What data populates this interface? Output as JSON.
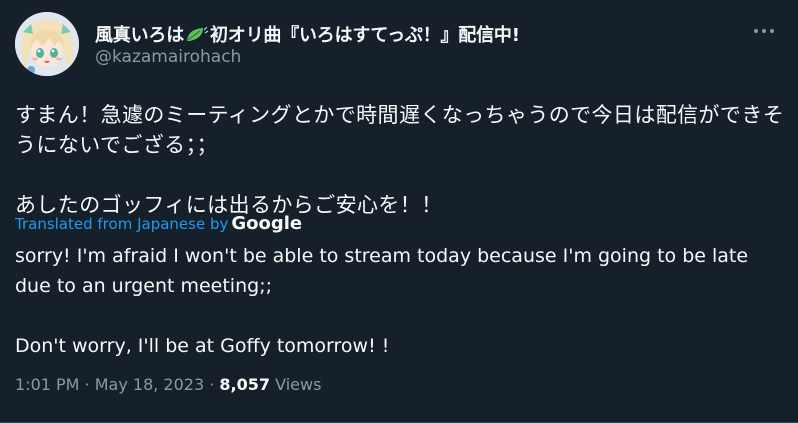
{
  "author": {
    "display_name_before": "風真いろは",
    "display_name_after": "初オリ曲『いろはすてっぷ！』配信中!",
    "handle": "@kazamairohach",
    "avatar_icon": "anime-avatar-icon",
    "name_emoji_icon": "leaf-icon"
  },
  "tweet": {
    "original_paragraphs": [
      "すまん！急遽のミーティングとかで時間遅くなっちゃうので今日は配信ができそうにないでござる；；",
      "あしたのゴッフィには出るからご安心を！！"
    ],
    "translated_label": "Translated from Japanese by",
    "translator": "Google",
    "translated_paragraphs": [
      "sorry! I'm afraid I won't be able to stream today because I'm going to be late due to an urgent meeting;;",
      "Don't worry, I'll be at Goffy tomorrow! !"
    ]
  },
  "meta": {
    "time": "1:01 PM",
    "separator1": " · ",
    "date": "May 18, 2023",
    "separator2": " · ",
    "views_count": "8,057",
    "views_label": " Views"
  },
  "colors": {
    "background": "#15202b",
    "text_primary": "#f7f9f9",
    "text_secondary": "#8b98a5",
    "link": "#1d9bf0"
  }
}
